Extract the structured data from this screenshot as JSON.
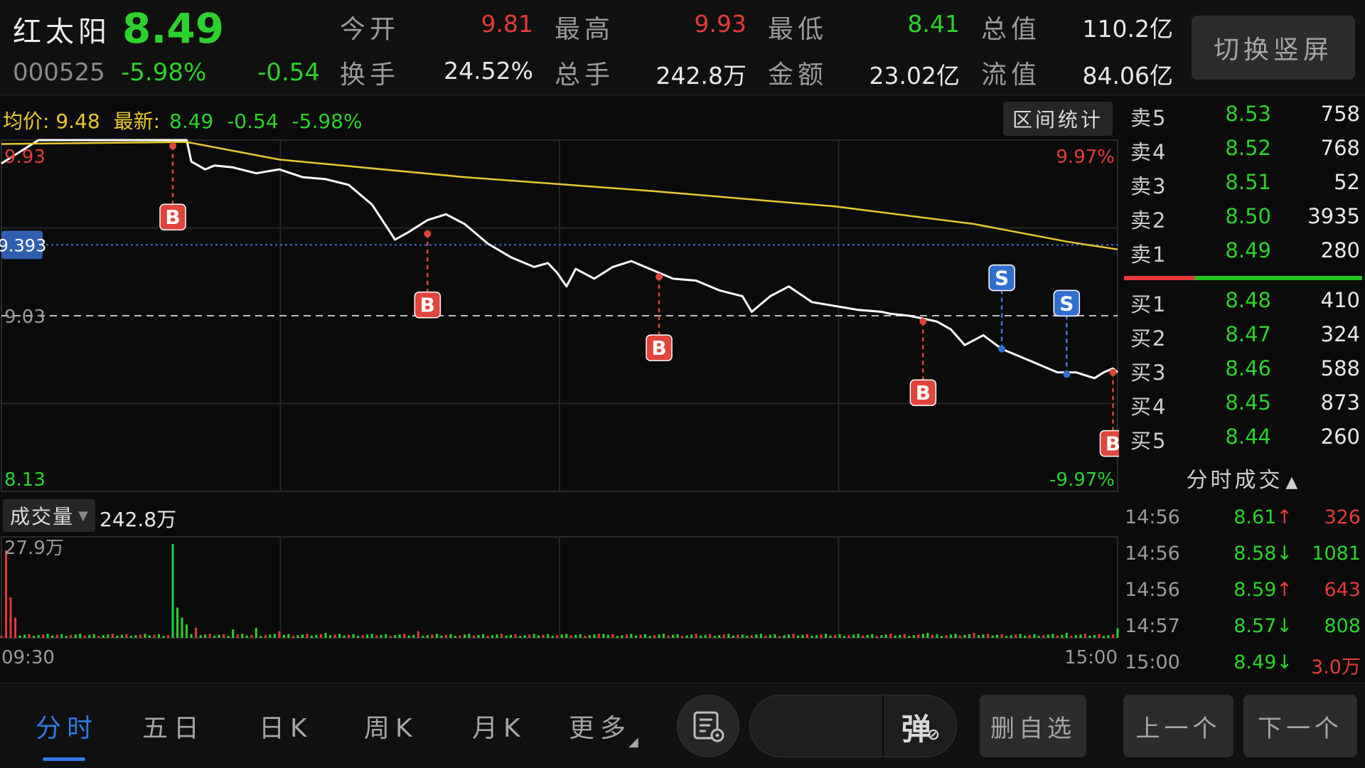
{
  "header": {
    "name": "红太阳",
    "price": "8.49",
    "code": "000525",
    "pct": "-5.98%",
    "change": "-0.54",
    "stats": [
      {
        "label": "今开",
        "value": "9.81",
        "color": "red"
      },
      {
        "label": "最高",
        "value": "9.93",
        "color": "red"
      },
      {
        "label": "最低",
        "value": "8.41",
        "color": "green"
      },
      {
        "label": "总值",
        "value": "110.2亿",
        "color": "white"
      },
      {
        "label": "换手",
        "value": "24.52%",
        "color": "white"
      },
      {
        "label": "总手",
        "value": "242.8万",
        "color": "white"
      },
      {
        "label": "金额",
        "value": "23.02亿",
        "color": "white"
      },
      {
        "label": "流值",
        "value": "84.06亿",
        "color": "white"
      }
    ],
    "switch_label": "切换竖屏"
  },
  "chart": {
    "legend_avg_label": "均价:",
    "legend_avg": "9.48",
    "legend_last_label": "最新:",
    "legend_last": "8.49",
    "legend_chg": "-0.54",
    "legend_pct": "-5.98%",
    "range_stats_label": "区间统计",
    "ref_price_tag": "9.393",
    "volume_selector_label": "成交量",
    "volume_total": "242.8万",
    "volume_max_label": "27.9万",
    "y_labels": {
      "top": "9.93",
      "mid": "9.03",
      "bottom": "8.13",
      "top_pct": "9.97%",
      "bottom_pct": "-9.97%"
    },
    "x_labels": {
      "start": "09:30",
      "end": "15:00"
    }
  },
  "chart_data": {
    "type": "line",
    "x_range": [
      "09:30",
      "15:00"
    ],
    "ylim": [
      8.13,
      9.93
    ],
    "prev_close": 9.03,
    "reference_line": 9.393,
    "series": [
      {
        "name": "最新",
        "color": "#ffffff",
        "points": [
          [
            0,
            9.81
          ],
          [
            8,
            9.93
          ],
          [
            40,
            9.93
          ],
          [
            41,
            9.82
          ],
          [
            44,
            9.78
          ],
          [
            46,
            9.8
          ],
          [
            50,
            9.79
          ],
          [
            55,
            9.76
          ],
          [
            60,
            9.78
          ],
          [
            65,
            9.74
          ],
          [
            70,
            9.73
          ],
          [
            75,
            9.7
          ],
          [
            80,
            9.6
          ],
          [
            85,
            9.42
          ],
          [
            88,
            9.46
          ],
          [
            92,
            9.52
          ],
          [
            96,
            9.55
          ],
          [
            100,
            9.5
          ],
          [
            105,
            9.4
          ],
          [
            110,
            9.33
          ],
          [
            115,
            9.28
          ],
          [
            118,
            9.3
          ],
          [
            120,
            9.25
          ],
          [
            122,
            9.18
          ],
          [
            124,
            9.27
          ],
          [
            128,
            9.22
          ],
          [
            132,
            9.28
          ],
          [
            136,
            9.31
          ],
          [
            140,
            9.27
          ],
          [
            145,
            9.22
          ],
          [
            150,
            9.21
          ],
          [
            155,
            9.16
          ],
          [
            160,
            9.13
          ],
          [
            162,
            9.05
          ],
          [
            166,
            9.13
          ],
          [
            170,
            9.18
          ],
          [
            175,
            9.1
          ],
          [
            180,
            9.08
          ],
          [
            185,
            9.06
          ],
          [
            190,
            9.05
          ],
          [
            192,
            9.04
          ],
          [
            196,
            9.03
          ],
          [
            198,
            9.02
          ],
          [
            202,
            9.0
          ],
          [
            205,
            8.96
          ],
          [
            208,
            8.88
          ],
          [
            212,
            8.93
          ],
          [
            216,
            8.86
          ],
          [
            220,
            8.82
          ],
          [
            224,
            8.78
          ],
          [
            228,
            8.74
          ],
          [
            232,
            8.74
          ],
          [
            236,
            8.71
          ],
          [
            238,
            8.74
          ],
          [
            240,
            8.76
          ],
          [
            241,
            8.74
          ]
        ]
      },
      {
        "name": "均价",
        "color": "#e8c832",
        "points": [
          [
            0,
            9.91
          ],
          [
            40,
            9.92
          ],
          [
            60,
            9.83
          ],
          [
            100,
            9.74
          ],
          [
            140,
            9.67
          ],
          [
            180,
            9.59
          ],
          [
            210,
            9.5
          ],
          [
            230,
            9.41
          ],
          [
            241,
            9.37
          ]
        ]
      }
    ],
    "trade_markers": [
      {
        "type": "B",
        "minute": 37,
        "price": 9.9
      },
      {
        "type": "B",
        "minute": 92,
        "price": 9.45
      },
      {
        "type": "B",
        "minute": 142,
        "price": 9.23
      },
      {
        "type": "B",
        "minute": 199,
        "price": 9.0
      },
      {
        "type": "S",
        "minute": 216,
        "price": 8.86
      },
      {
        "type": "S",
        "minute": 230,
        "price": 8.73
      },
      {
        "type": "B",
        "minute": 240,
        "price": 8.74
      }
    ],
    "volume": {
      "max": 27.9,
      "bars": [
        [
          1,
          26
        ],
        [
          2,
          12
        ],
        [
          3,
          6
        ],
        [
          37,
          27.9
        ],
        [
          38,
          9
        ],
        [
          39,
          6
        ],
        [
          40,
          4
        ],
        [
          42,
          3
        ],
        [
          50,
          2.5
        ],
        [
          55,
          3
        ],
        [
          60,
          2
        ],
        [
          70,
          1.5
        ],
        [
          90,
          2
        ],
        [
          100,
          1
        ],
        [
          130,
          1.2
        ],
        [
          160,
          1
        ],
        [
          200,
          1.5
        ],
        [
          210,
          1.5
        ],
        [
          220,
          1.2
        ],
        [
          230,
          1.5
        ],
        [
          241,
          2.8
        ]
      ]
    }
  },
  "order_book": {
    "sell": [
      {
        "label": "卖5",
        "price": "8.53",
        "qty": "758"
      },
      {
        "label": "卖4",
        "price": "8.52",
        "qty": "768"
      },
      {
        "label": "卖3",
        "price": "8.51",
        "qty": "52"
      },
      {
        "label": "卖2",
        "price": "8.50",
        "qty": "3935"
      },
      {
        "label": "卖1",
        "price": "8.49",
        "qty": "280"
      }
    ],
    "buy": [
      {
        "label": "买1",
        "price": "8.48",
        "qty": "410"
      },
      {
        "label": "买2",
        "price": "8.47",
        "qty": "324"
      },
      {
        "label": "买3",
        "price": "8.46",
        "qty": "588"
      },
      {
        "label": "买4",
        "price": "8.45",
        "qty": "873"
      },
      {
        "label": "买5",
        "price": "8.44",
        "qty": "260"
      }
    ]
  },
  "trades": {
    "title": "分时成交",
    "rows": [
      {
        "time": "14:56",
        "price": "8.61",
        "arrow": "↑",
        "vol": "326",
        "vcolor": "red"
      },
      {
        "time": "14:56",
        "price": "8.58",
        "arrow": "↓",
        "vol": "1081",
        "vcolor": "green"
      },
      {
        "time": "14:56",
        "price": "8.59",
        "arrow": "↑",
        "vol": "643",
        "vcolor": "red"
      },
      {
        "time": "14:57",
        "price": "8.57",
        "arrow": "↓",
        "vol": "808",
        "vcolor": "green"
      },
      {
        "time": "15:00",
        "price": "8.49",
        "arrow": "↓",
        "vol": "3.0万",
        "vcolor": "red"
      }
    ]
  },
  "bottom": {
    "tabs": [
      "分时",
      "五日",
      "日K",
      "周K",
      "月K",
      "更多"
    ],
    "danmu_label": "弹",
    "danmu_placeholder": "",
    "remove_watch": "删自选",
    "prev": "上一个",
    "next": "下一个"
  },
  "colors": {
    "up": "#e53a3a",
    "down": "#2bd22b",
    "accent": "#2f7ae8",
    "avg": "#e8c832"
  }
}
